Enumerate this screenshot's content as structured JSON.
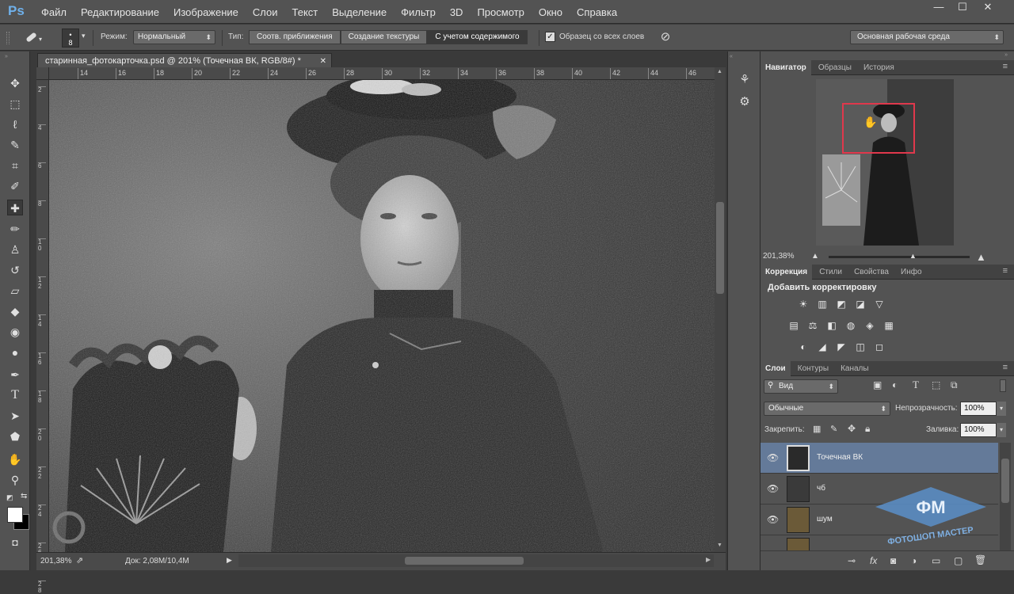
{
  "app": {
    "logo": "Ps"
  },
  "menu": [
    "Файл",
    "Редактирование",
    "Изображение",
    "Слои",
    "Текст",
    "Выделение",
    "Фильтр",
    "3D",
    "Просмотр",
    "Окно",
    "Справка"
  ],
  "window_controls": [
    "—",
    "☐",
    "✕"
  ],
  "options": {
    "brush_size": "8",
    "mode_label": "Режим:",
    "mode_value": "Нормальный",
    "type_label": "Тип:",
    "type_buttons": [
      "Соотв. приближения",
      "Создание текстуры",
      "С учетом содержимого"
    ],
    "sample_all_label": "Образец со всех слоев",
    "workspace": "Основная рабочая среда"
  },
  "document": {
    "tab_title": "старинная_фотокарточка.psd @ 201% (Точечная ВК, RGB/8#) *",
    "ruler_h": [
      "14",
      "16",
      "18",
      "20",
      "22",
      "24",
      "26",
      "28",
      "30",
      "32",
      "34",
      "36",
      "38",
      "40",
      "42",
      "44",
      "46"
    ],
    "ruler_v": [
      "2",
      "4",
      "6",
      "8",
      "1 0",
      "1 2",
      "1 4",
      "1 6",
      "1 8",
      "2 0",
      "2 2",
      "2 4",
      "2 6",
      "2 8"
    ],
    "zoom": "201,38%",
    "doc_info": "Док: 2,08M/10,4M"
  },
  "navigator": {
    "tabs": [
      "Навигатор",
      "Образцы",
      "История"
    ],
    "zoom": "201,38%"
  },
  "adjustments": {
    "tabs": [
      "Коррекция",
      "Стили",
      "Свойства",
      "Инфо"
    ],
    "title": "Добавить корректировку",
    "icons_row1": [
      "☀",
      "▥",
      "◩",
      "◪",
      "▽"
    ],
    "icons_row2": [
      "▤",
      "⚖",
      "◧",
      "◍",
      "◈",
      "▦"
    ],
    "icons_row3": [
      "◐",
      "◢",
      "◤",
      "◫",
      "◻"
    ]
  },
  "layers": {
    "tabs": [
      "Слои",
      "Контуры",
      "Каналы"
    ],
    "filter": "Вид",
    "blend": "Обычные",
    "opacity_label": "Непрозрачность:",
    "opacity": "100%",
    "lock_label": "Закрепить:",
    "fill_label": "Заливка:",
    "fill": "100%",
    "items": [
      {
        "name": "Точечная ВК",
        "selected": true
      },
      {
        "name": "чб",
        "selected": false
      },
      {
        "name": "шум",
        "selected": false
      }
    ],
    "bottom_icons": [
      "⊸",
      "fx",
      "◙",
      "◑",
      "▭",
      "▢",
      "🗑"
    ]
  },
  "watermark": {
    "line1": "ФМ",
    "line2": "ФОТОШОП МАСТЕР"
  }
}
